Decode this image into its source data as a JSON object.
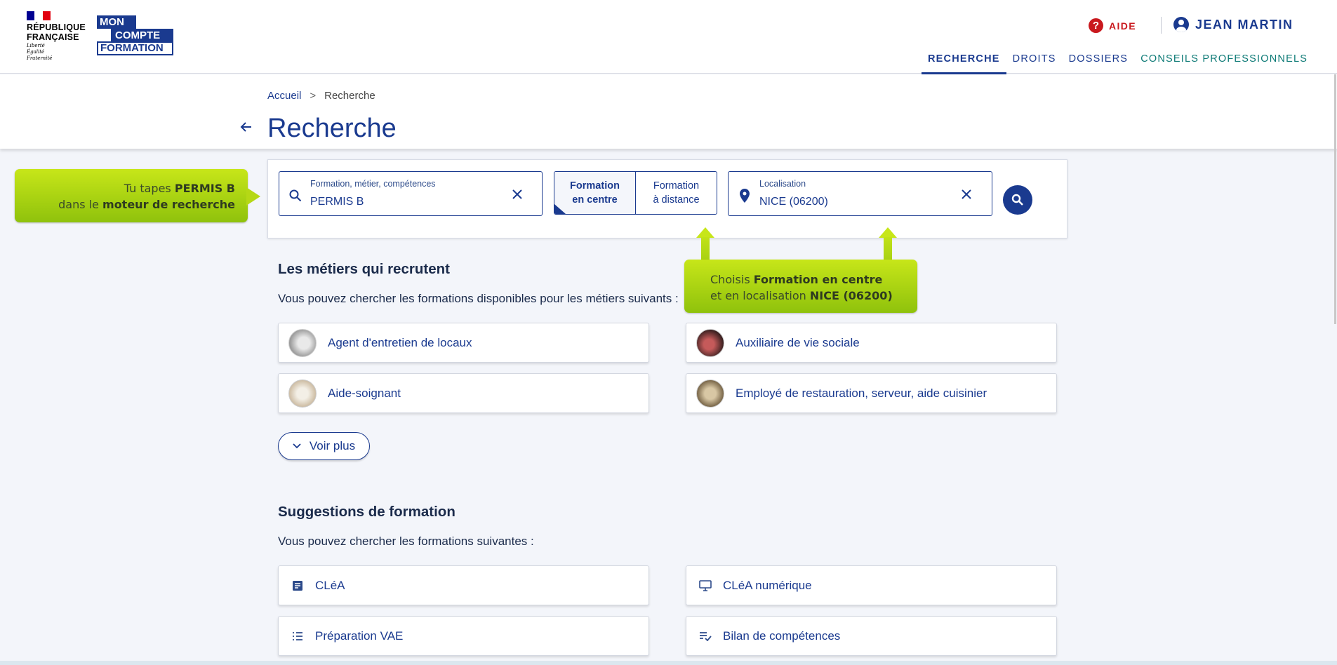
{
  "header": {
    "republic_logo_lines": [
      "RÉPUBLIQUE",
      "FRANÇAISE"
    ],
    "republic_motto": [
      "Liberté",
      "Égalité",
      "Fraternité"
    ],
    "brand_logo_lines": [
      "MON",
      "COMPTE",
      "FORMATION"
    ],
    "help_label": "AIDE",
    "help_icon": "?",
    "user_name": "JEAN MARTIN",
    "nav": [
      {
        "label": "RECHERCHE",
        "active": true
      },
      {
        "label": "DROITS",
        "active": false
      },
      {
        "label": "DOSSIERS",
        "active": false
      },
      {
        "label": "CONSEILS PROFESSIONNELS",
        "active": false
      }
    ]
  },
  "breadcrumb": {
    "home": "Accueil",
    "separator": ">",
    "current": "Recherche"
  },
  "page_title": "Recherche",
  "search": {
    "query_label": "Formation, métier, compétences",
    "query_value": "PERMIS B",
    "mode_options": [
      {
        "label": "Formation en centre",
        "selected": true
      },
      {
        "label": "Formation à distance",
        "selected": false
      }
    ],
    "location_label": "Localisation",
    "location_value": "NICE (06200)"
  },
  "callouts": {
    "left": {
      "line1_pre": "Tu tapes ",
      "line1_bold": "PERMIS B",
      "line2_pre": "dans le ",
      "line2_bold": "moteur de recherche"
    },
    "right": {
      "line1_pre": "Choisis ",
      "line1_bold": "Formation en centre",
      "line2_pre": "et en localisation ",
      "line2_bold": "NICE (06200)"
    }
  },
  "jobs_section": {
    "title": "Les métiers qui recrutent",
    "subtitle": "Vous pouvez chercher les formations disponibles pour les métiers suivants :",
    "items": [
      {
        "label": "Agent d'entretien de locaux"
      },
      {
        "label": "Auxiliaire de vie sociale"
      },
      {
        "label": "Aide-soignant"
      },
      {
        "label": "Employé de restauration, serveur, aide cuisinier"
      }
    ],
    "more_label": "Voir plus"
  },
  "suggestions_section": {
    "title": "Suggestions de formation",
    "subtitle": "Vous pouvez chercher les formations suivantes :",
    "items": [
      {
        "label": "CLéA",
        "icon": "document-icon"
      },
      {
        "label": "CLéA numérique",
        "icon": "monitor-icon"
      },
      {
        "label": "Préparation VAE",
        "icon": "list-icon"
      },
      {
        "label": "Bilan de compétences",
        "icon": "checklist-icon"
      }
    ]
  },
  "colors": {
    "primary": "#1a3a8f",
    "help_red": "#c9191e",
    "callout_green": "#b5d816",
    "nav_teal": "#0d7a76",
    "background": "#f3f5fa"
  }
}
